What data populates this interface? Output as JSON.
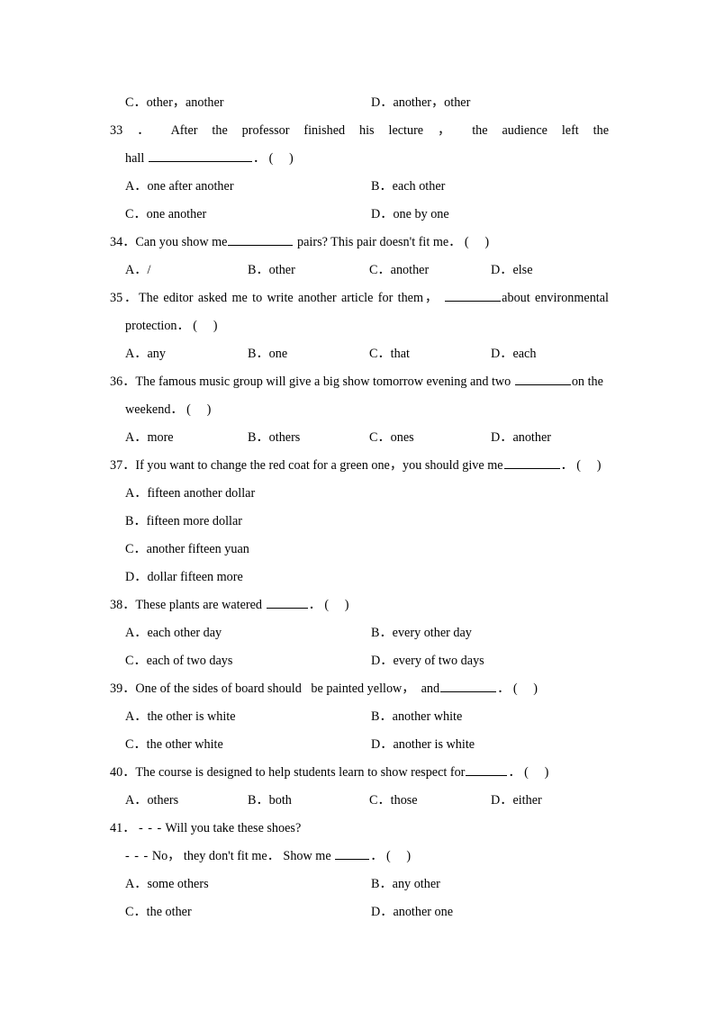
{
  "document": {
    "type": "english-grammar-multiple-choice-worksheet",
    "paren_marker": "(     )",
    "dialogue_dash": "- - -"
  },
  "items": [
    {
      "id": "q32-options-continued",
      "layout": "two-column-options",
      "options": [
        {
          "letter": "C．",
          "text": "other，another"
        },
        {
          "letter": "D．",
          "text": "another，other"
        }
      ]
    },
    {
      "id": "q33",
      "number": "33 ．",
      "stem_line1": "After the professor finished his lecture ， the audience left the",
      "stem_line2_before": "hall",
      "stem_line2_after": "．",
      "blank_size": "xl",
      "layout": "two-column-options",
      "options": [
        {
          "letter": "A．",
          "text": "one after another"
        },
        {
          "letter": "B．",
          "text": "each other"
        },
        {
          "letter": "C．",
          "text": "one another"
        },
        {
          "letter": "D．",
          "text": "one by one"
        }
      ]
    },
    {
      "id": "q34",
      "number": "34．",
      "stem_before": "Can you show me",
      "stem_after": "pairs? This pair doesn't fit me．",
      "blank_size": "lg",
      "layout": "four-column-options",
      "options": [
        {
          "letter": "A．",
          "text": "/"
        },
        {
          "letter": "B．",
          "text": "other"
        },
        {
          "letter": "C．",
          "text": "another"
        },
        {
          "letter": "D．",
          "text": "else"
        }
      ]
    },
    {
      "id": "q35",
      "number": "35．",
      "stem_line1_before": "The editor asked me to write another article for them，",
      "stem_line1_after": "about environmental",
      "stem_line2": "protection．",
      "blank_size": "md",
      "layout": "four-column-options",
      "options": [
        {
          "letter": "A．",
          "text": "any"
        },
        {
          "letter": "B．",
          "text": "one"
        },
        {
          "letter": "C．",
          "text": "that"
        },
        {
          "letter": "D．",
          "text": "each"
        }
      ]
    },
    {
      "id": "q36",
      "number": "36．",
      "stem_line1_before": "The famous music group will give a big show tomorrow evening and two",
      "stem_line1_after": "on the",
      "stem_line2": "weekend．",
      "blank_size": "md",
      "layout": "four-column-options",
      "options": [
        {
          "letter": "A．",
          "text": "more"
        },
        {
          "letter": "B．",
          "text": "others"
        },
        {
          "letter": "C．",
          "text": "ones"
        },
        {
          "letter": "D．",
          "text": "another"
        }
      ]
    },
    {
      "id": "q37",
      "number": "37．",
      "stem_before": "If you want to change the red coat for a green one，you should give me",
      "stem_after": "．",
      "blank_size": "md",
      "layout": "one-column-options",
      "options": [
        {
          "letter": "A．",
          "text": "fifteen another dollar"
        },
        {
          "letter": "B．",
          "text": "fifteen more dollar"
        },
        {
          "letter": "C．",
          "text": "another fifteen yuan"
        },
        {
          "letter": "D．",
          "text": "dollar fifteen more"
        }
      ]
    },
    {
      "id": "q38",
      "number": "38．",
      "stem_before": "These plants are watered",
      "stem_after": "．",
      "blank_size": "sm",
      "layout": "two-column-options",
      "options": [
        {
          "letter": "A．",
          "text": "each other day"
        },
        {
          "letter": "B．",
          "text": "every other day"
        },
        {
          "letter": "C．",
          "text": "each of two days"
        },
        {
          "letter": "D．",
          "text": "every of two days"
        }
      ]
    },
    {
      "id": "q39",
      "number": "39．",
      "stem_before": "One of the sides of board should   be painted yellow，  and",
      "stem_after": "．",
      "blank_size": "md",
      "layout": "two-column-options",
      "options": [
        {
          "letter": "A．",
          "text": "the other is white"
        },
        {
          "letter": "B．",
          "text": "another white"
        },
        {
          "letter": "C．",
          "text": "the other white"
        },
        {
          "letter": "D．",
          "text": "another is white"
        }
      ]
    },
    {
      "id": "q40",
      "number": "40．",
      "stem_before": "The course is designed to help students learn to show respect for",
      "stem_after": "．",
      "blank_size": "sm",
      "layout": "four-column-options",
      "options": [
        {
          "letter": "A．",
          "text": "others"
        },
        {
          "letter": "B．",
          "text": "both"
        },
        {
          "letter": "C．",
          "text": "those"
        },
        {
          "letter": "D．",
          "text": "either"
        }
      ]
    },
    {
      "id": "q41",
      "number": "41．",
      "dialogue_line1": "Will you take these shoes?",
      "dialogue_line2_before": "No，  they don't fit me．  Show me",
      "dialogue_line2_after": "．",
      "blank_size": "xs",
      "layout": "two-column-options",
      "options": [
        {
          "letter": "A．",
          "text": "some others"
        },
        {
          "letter": "B．",
          "text": "any other"
        },
        {
          "letter": "C．",
          "text": "the other"
        },
        {
          "letter": "D．",
          "text": "another one"
        }
      ]
    }
  ]
}
